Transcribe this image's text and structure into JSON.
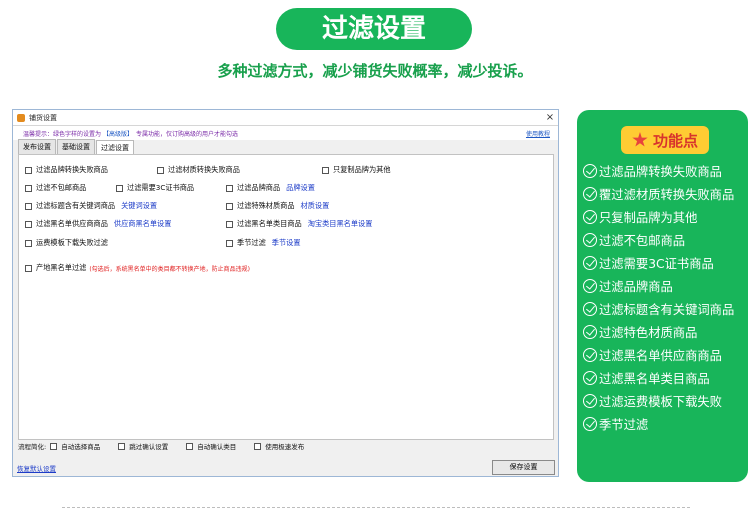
{
  "header": {
    "banner": "过滤设置",
    "subtitle": "多种过滤方式，减少铺货失败概率，减少投诉。"
  },
  "window": {
    "title": "铺货设置",
    "close": "×",
    "tip_prefix": "温馨提示：绿色字样的设置为",
    "tip_vip": "【高级版】",
    "tip_suffix": "专属功能，仅订购高级的用户才能勾选",
    "help_link": "使用教程",
    "tabs": [
      "发布设置",
      "基础设置",
      "过滤设置"
    ],
    "options": {
      "brand_fail": "过滤品牌转换失败商品",
      "material_fail": "过滤材质转换失败商品",
      "copy_brand_other": "只复制品牌为其他",
      "no_free_ship": "过滤不包邮商品",
      "need_3c": "过滤需要3C证书商品",
      "brand_goods": "过滤品牌商品",
      "brand_settings_link": "品牌设置",
      "title_keywords": "过滤标题含有关键词商品",
      "keyword_settings_link": "关键词设置",
      "special_material": "过滤特殊材质商品",
      "material_settings_link": "材质设置",
      "blacklist_supplier": "过滤黑名单供应商商品",
      "supplier_blacklist_link": "供应商黑名单设置",
      "blacklist_category": "过滤黑名单类目商品",
      "taobao_category_link": "淘宝类目黑名单设置",
      "freight_template": "运费模板下载失败过滤",
      "season": "季节过滤",
      "season_settings_link": "季节设置",
      "origin_blacklist": "产地黑名单过滤",
      "origin_note": "(勾选后，系统黑名单中的类目都不转换产地，防止商品违规)"
    },
    "flow": {
      "label": "流程简化:",
      "items": [
        "自动选择商品",
        "跳过确认设置",
        "自动确认类目",
        "使用极速发布"
      ]
    },
    "restore_link": "恢复默认设置",
    "save_button": "保存设置"
  },
  "feature_card": {
    "title": "功能点",
    "items": [
      "过滤品牌转换失败商品",
      "覆过滤材质转换失败商品",
      "只复制品牌为其他",
      "过滤不包邮商品",
      "过滤需要3C证书商品",
      "过滤品牌商品",
      "过滤标题含有关键词商品",
      "过滤特色材质商品",
      " 过滤黑名单供应商商品",
      "过滤黑名单类目商品",
      "过滤运费模板下载失败",
      "季节过滤"
    ],
    "colors": {
      "card": "#18b55a",
      "badge": "#ffcc33",
      "star": "#e8443c"
    }
  }
}
